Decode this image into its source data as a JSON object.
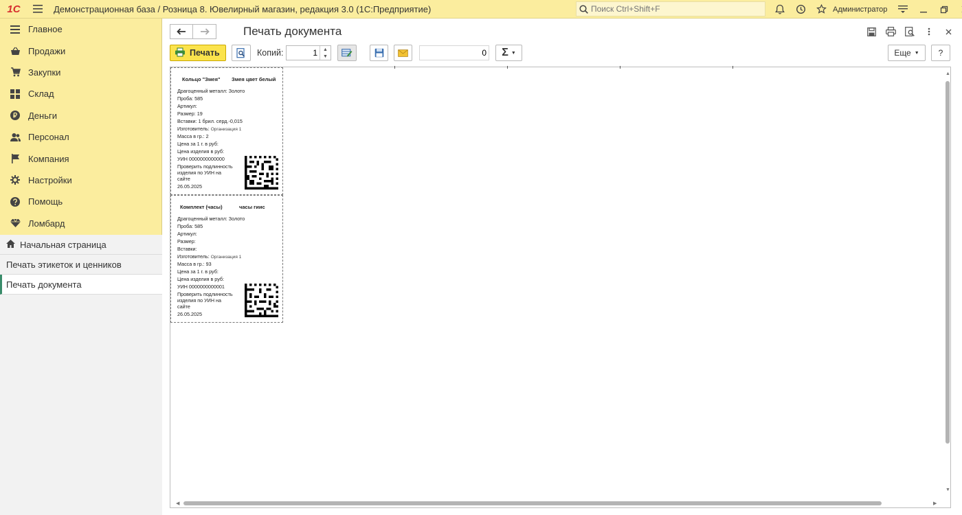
{
  "app": {
    "logo": "1С",
    "title": "Демонстрационная база / Розница 8. Ювелирный магазин, редакция 3.0  (1С:Предприятие)",
    "search_placeholder": "Поиск Ctrl+Shift+F",
    "user": "Администратор"
  },
  "sidebar": {
    "items": [
      {
        "label": "Главное",
        "icon": "menu-lines-icon"
      },
      {
        "label": "Продажи",
        "icon": "basket-icon"
      },
      {
        "label": "Закупки",
        "icon": "cart-icon"
      },
      {
        "label": "Склад",
        "icon": "grid-icon"
      },
      {
        "label": "Деньги",
        "icon": "ruble-icon"
      },
      {
        "label": "Персонал",
        "icon": "people-icon"
      },
      {
        "label": "Компания",
        "icon": "flag-icon"
      },
      {
        "label": "Настройки",
        "icon": "gear-icon"
      },
      {
        "label": "Помощь",
        "icon": "question-icon"
      },
      {
        "label": "Ломбард",
        "icon": "diamond-icon"
      }
    ],
    "open_windows": [
      {
        "label": "Начальная страница"
      },
      {
        "label": "Печать этикеток и ценников"
      },
      {
        "label": "Печать документа"
      }
    ]
  },
  "main": {
    "title": "Печать документа",
    "toolbar": {
      "print_label": "Печать",
      "copies_label": "Копий:",
      "copies_value": "1",
      "sum_value": "0",
      "sum_symbol": "Σ",
      "more_label": "Еще",
      "help_label": "?"
    }
  },
  "document": {
    "labels": [
      {
        "name": "Кольцо \"Змея\"",
        "variant": "Змея цвет белый",
        "metal": "Драгоценный металл:  Золото",
        "probe": "Проба:     585",
        "article": "Артикул:",
        "size": "Размер:    19",
        "inserts": "Вставки:  1 брил. серд.-0,015",
        "maker_label": "Изготовитель:",
        "maker_value": "Организация 1",
        "mass": "Масса в гр.:  2",
        "price_gram": "Цена за 1 г. в руб:",
        "price_item": "Цена изделия в руб:",
        "uin": "УИН  0000000000000",
        "check_1": "Проверить подлинность",
        "check_2": "изделия по УИН на",
        "check_3": "сайте",
        "date": "26.05.2025"
      },
      {
        "name": "Комплект (часы)",
        "variant": "часы гиис",
        "metal": "Драгоценный металл:  Золото",
        "probe": "Проба:     585",
        "article": "Артикул:",
        "size": "Размер:",
        "inserts": "Вставки:",
        "maker_label": "Изготовитель:",
        "maker_value": "Организация 1",
        "mass": "Масса в гр.:  93",
        "price_gram": "Цена за 1 г. в руб:",
        "price_item": "Цена изделия в руб:",
        "uin": "УИН  0000000000001",
        "check_1": "Проверить подлинность",
        "check_2": "изделия по УИН на",
        "check_3": "сайте",
        "date": "26.05.2025"
      }
    ]
  }
}
